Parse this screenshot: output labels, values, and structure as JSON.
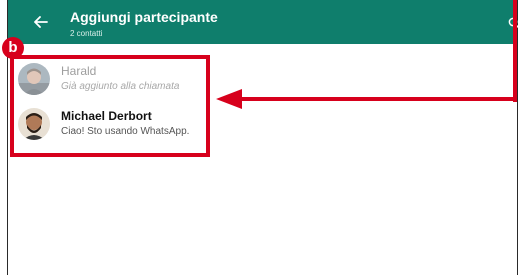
{
  "header": {
    "title": "Aggiungi partecipante",
    "subtitle": "2 contatti",
    "back_icon": "arrow-left-icon",
    "search_icon": "search-icon",
    "color": "#0f7e6c"
  },
  "annotation": {
    "badge_label": "b",
    "color": "#d7001c"
  },
  "contacts": [
    {
      "name": "Harald",
      "status": "Già aggiunto alla chiamata",
      "state": "disabled"
    },
    {
      "name": "Michael Derbort",
      "status": "Ciao! Sto usando WhatsApp.",
      "state": "enabled"
    }
  ]
}
